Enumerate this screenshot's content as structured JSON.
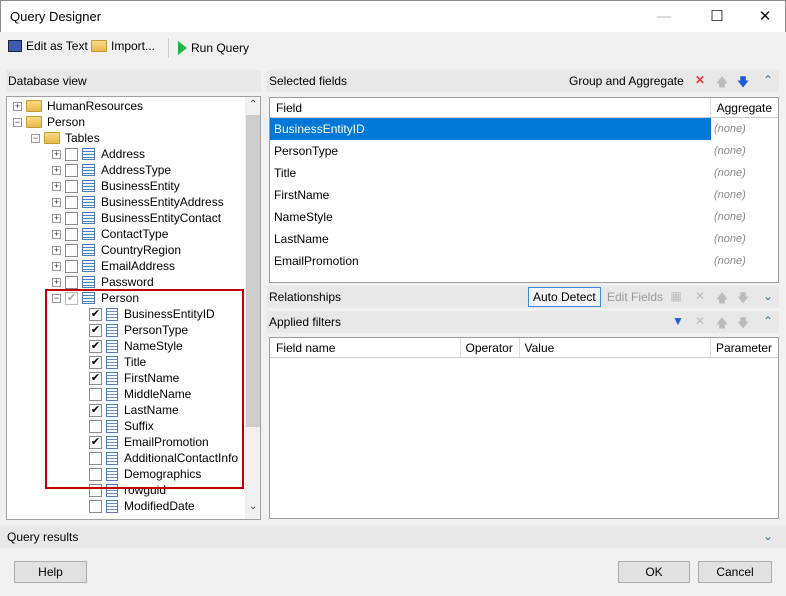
{
  "window": {
    "title": "Query Designer"
  },
  "toolbar": {
    "edit_as_text": "Edit as Text",
    "import": "Import...",
    "run_query": "Run Query"
  },
  "database_view": {
    "title": "Database view",
    "schemas": [
      {
        "label": "HumanResources",
        "expanded": false
      },
      {
        "label": "Person",
        "expanded": true
      }
    ],
    "tables_folder": "Tables",
    "tables": [
      "Address",
      "AddressType",
      "BusinessEntity",
      "BusinessEntityAddress",
      "BusinessEntityContact",
      "ContactType",
      "CountryRegion",
      "EmailAddress",
      "Password",
      "Person"
    ],
    "person_columns": [
      {
        "label": "BusinessEntityID",
        "checked": true
      },
      {
        "label": "PersonType",
        "checked": true
      },
      {
        "label": "NameStyle",
        "checked": true
      },
      {
        "label": "Title",
        "checked": true
      },
      {
        "label": "FirstName",
        "checked": true
      },
      {
        "label": "MiddleName",
        "checked": false
      },
      {
        "label": "LastName",
        "checked": true
      },
      {
        "label": "Suffix",
        "checked": false
      },
      {
        "label": "EmailPromotion",
        "checked": true
      },
      {
        "label": "AdditionalContactInfo",
        "checked": false
      },
      {
        "label": "Demographics",
        "checked": false
      },
      {
        "label": "rowguid",
        "checked": false
      },
      {
        "label": "ModifiedDate",
        "checked": false
      }
    ]
  },
  "selected_fields": {
    "title": "Selected fields",
    "group_and_aggregate": "Group and Aggregate",
    "columns": [
      "Field",
      "Aggregate"
    ],
    "rows": [
      {
        "field": "BusinessEntityID",
        "aggregate": "(none)"
      },
      {
        "field": "PersonType",
        "aggregate": "(none)"
      },
      {
        "field": "Title",
        "aggregate": "(none)"
      },
      {
        "field": "FirstName",
        "aggregate": "(none)"
      },
      {
        "field": "NameStyle",
        "aggregate": "(none)"
      },
      {
        "field": "LastName",
        "aggregate": "(none)"
      },
      {
        "field": "EmailPromotion",
        "aggregate": "(none)"
      }
    ]
  },
  "relationships": {
    "title": "Relationships",
    "auto_detect": "Auto Detect",
    "edit_fields": "Edit Fields"
  },
  "applied_filters": {
    "title": "Applied filters",
    "columns": [
      "Field name",
      "Operator",
      "Value",
      "Parameter"
    ]
  },
  "query_results": {
    "title": "Query results"
  },
  "buttons": {
    "help": "Help",
    "ok": "OK",
    "cancel": "Cancel"
  },
  "colors": {
    "selection": "#0078d7",
    "highlight_box": "#c00000",
    "run_green": "#22b14c"
  }
}
